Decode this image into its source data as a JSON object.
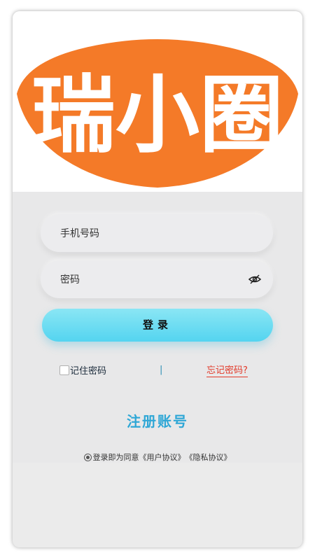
{
  "banner": {
    "logo_text": "瑞小圈",
    "brand_color": "#f47a28"
  },
  "login_form": {
    "phone_placeholder": "手机号码",
    "password_placeholder": "密码",
    "password_visibility_icon": "eye-off-icon",
    "login_label": "登录",
    "remember_label": "记住密码",
    "divider": "|",
    "forgot_label": "忘记密码?",
    "register_label": "注册账号"
  },
  "agreement": {
    "prefix": "登录即为同意",
    "user_agreement": "《用户协议》",
    "privacy_agreement": "《隐私协议》"
  },
  "colors": {
    "accent": "#2fa7d6",
    "login_button": "#6ddcf2",
    "forgot_link": "#e23a2a"
  }
}
